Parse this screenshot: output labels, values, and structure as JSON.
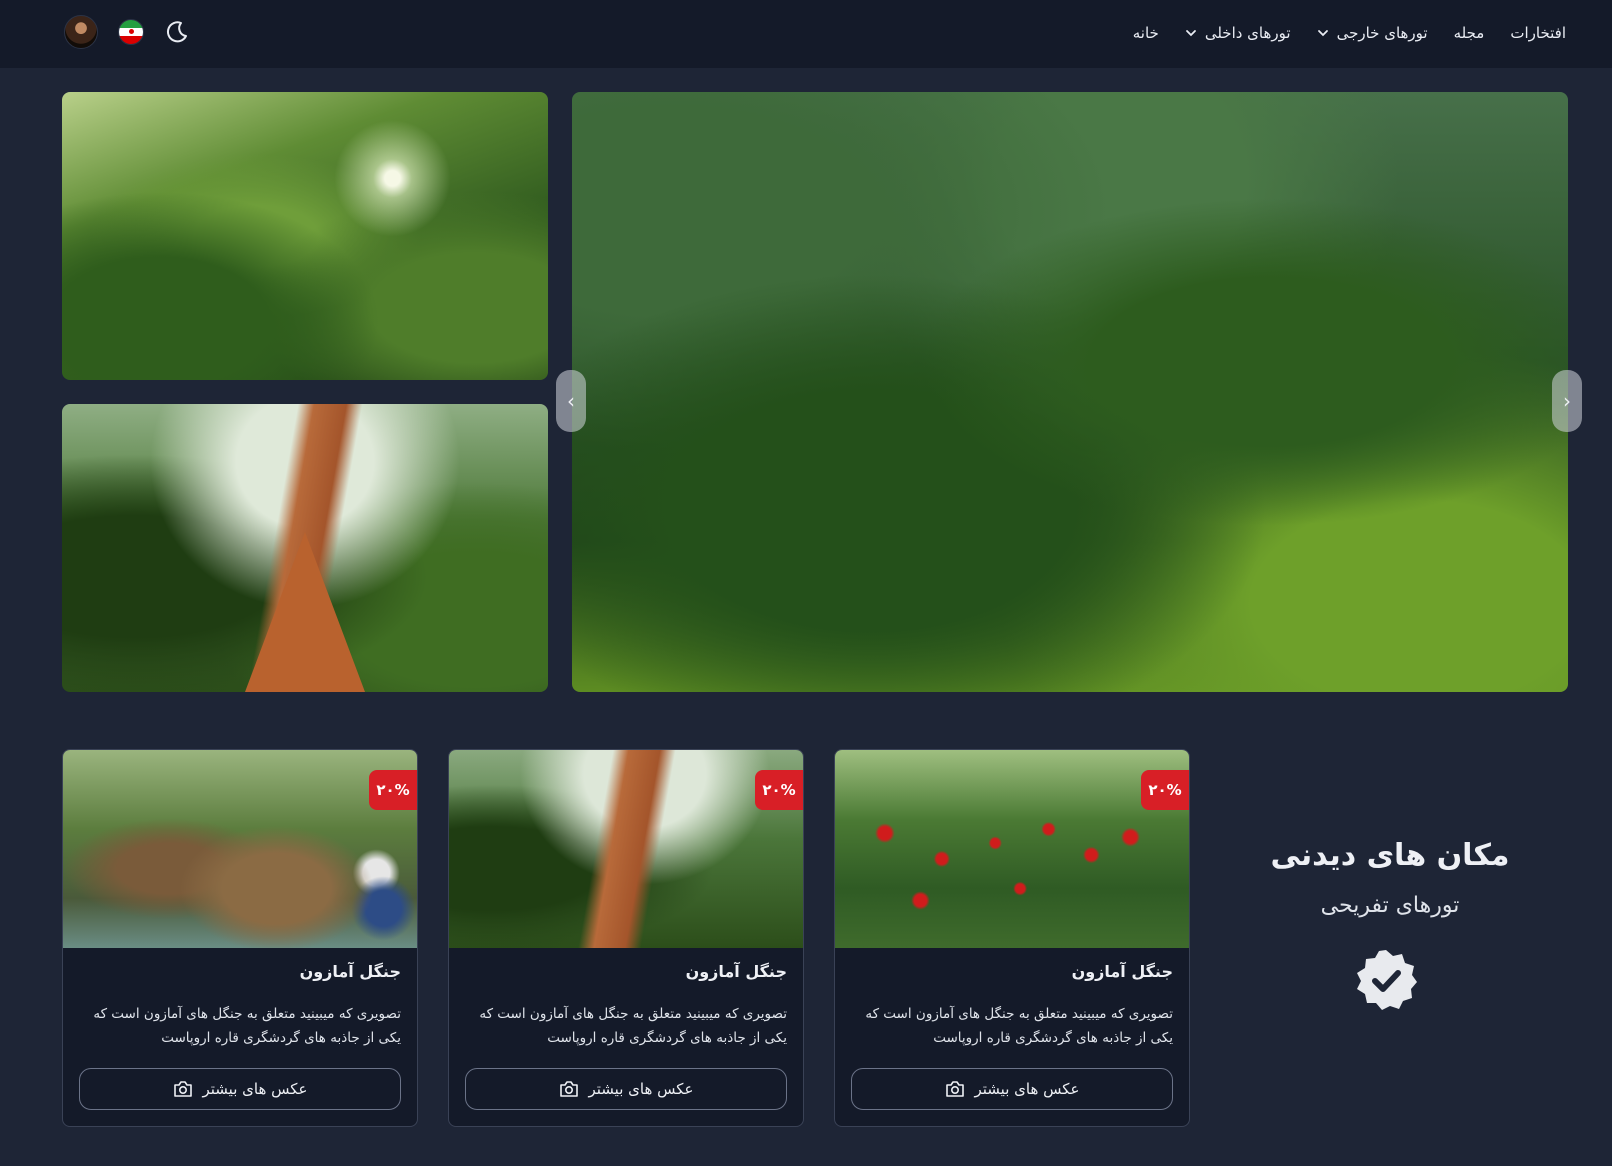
{
  "nav": {
    "links": [
      {
        "label": "خانه",
        "has_dropdown": false
      },
      {
        "label": "تورهای داخلی",
        "has_dropdown": true
      },
      {
        "label": "تورهای خارجی",
        "has_dropdown": true
      },
      {
        "label": "مجله",
        "has_dropdown": false
      },
      {
        "label": "افتخارات",
        "has_dropdown": false
      }
    ],
    "icons": [
      "avatar",
      "iran-flag-icon",
      "moon-icon"
    ]
  },
  "gallery": {
    "slider_prev": "‹",
    "slider_next": "›"
  },
  "section": {
    "title": "مکان های دیدنی",
    "subtitle": "تورهای تفریحی",
    "badge_icon": "check-badge-icon"
  },
  "cards": [
    {
      "discount": "۲۰%",
      "title": "جنگل آمازون",
      "desc": "تصویری که میبینید متعلق به جنگل های آمازون است که یکی از جاذبه های گردشگری قاره اروپاست",
      "button": "عکس های بیشتر"
    },
    {
      "discount": "۲۰%",
      "title": "جنگل آمازون",
      "desc": "تصویری که میبینید متعلق به جنگل های آمازون است که یکی از جاذبه های گردشگری قاره اروپاست",
      "button": "عکس های بیشتر"
    },
    {
      "discount": "۲۰%",
      "title": "جنگل آمازون",
      "desc": "تصویری که میبینید متعلق به جنگل های آمازون است که یکی از جاذبه های گردشگری قاره اروپاست",
      "button": "عکس های بیشتر"
    }
  ],
  "colors": {
    "background": "#1e2536",
    "navbar": "#141a29",
    "discount": "#d81f26"
  }
}
